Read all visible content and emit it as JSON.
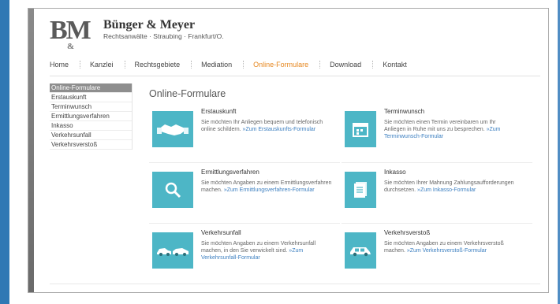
{
  "brand": {
    "logo_letters": "BM",
    "logo_amp": "&",
    "name": "Bünger & Meyer",
    "subtitle": "Rechtsanwälte · Straubing · Frankfurt/O."
  },
  "nav": [
    {
      "label": "Home"
    },
    {
      "label": "Kanzlei"
    },
    {
      "label": "Rechtsgebiete"
    },
    {
      "label": "Mediation"
    },
    {
      "label": "Online-Formulare",
      "active": true
    },
    {
      "label": "Download"
    },
    {
      "label": "Kontakt"
    }
  ],
  "sidebar": [
    {
      "label": "Online-Formulare",
      "active": true
    },
    {
      "label": "Erstauskunft"
    },
    {
      "label": "Terminwunsch"
    },
    {
      "label": "Ermittlungsverfahren"
    },
    {
      "label": "Inkasso"
    },
    {
      "label": "Verkehrsunfall"
    },
    {
      "label": "Verkehrsverstoß"
    }
  ],
  "content": {
    "title": "Online-Formulare",
    "cards": [
      {
        "title": "Erstauskunft",
        "icon": "handshake-icon",
        "desc": "Sie möchten Ihr Anliegen bequem und telefonisch online schildern.",
        "link": "»Zum Erstauskunfts-Formular"
      },
      {
        "title": "Terminwunsch",
        "icon": "calendar-icon",
        "desc": "Sie möchten einen Termin vereinbaren um Ihr Anliegen in Ruhe mit uns zu besprechen.",
        "link": "»Zum Terminwunsch-Formular"
      },
      {
        "title": "Ermittlungsverfahren",
        "icon": "magnifier-icon",
        "desc": "Sie möchten Angaben zu einem Ermittlungsverfahren machen.",
        "link": "»Zum Ermittlungsverfahren-Formular"
      },
      {
        "title": "Inkasso",
        "icon": "document-icon",
        "desc": "Sie möchten Ihrer Mahnung Zahlungsaufforderungen durchsetzen.",
        "link": "»Zum Inkasso-Formular"
      },
      {
        "title": "Verkehrsunfall",
        "icon": "car-crash-icon",
        "desc": "Sie möchten Angaben zu einem Verkehrsunfall machen, in den Sie verwickelt sind.",
        "link": "»Zum Verkehrsunfall-Formular"
      },
      {
        "title": "Verkehrsverstoß",
        "icon": "car-icon",
        "desc": "Sie möchten Angaben zu einem Verkehrsverstoß machen.",
        "link": "»Zum Verkehrsverstoß-Formular"
      }
    ]
  },
  "colors": {
    "frame_blue": "#2f78b4",
    "accent_orange": "#e6871f",
    "icon_teal": "#4db6c6",
    "link_blue": "#3c7fc0"
  }
}
